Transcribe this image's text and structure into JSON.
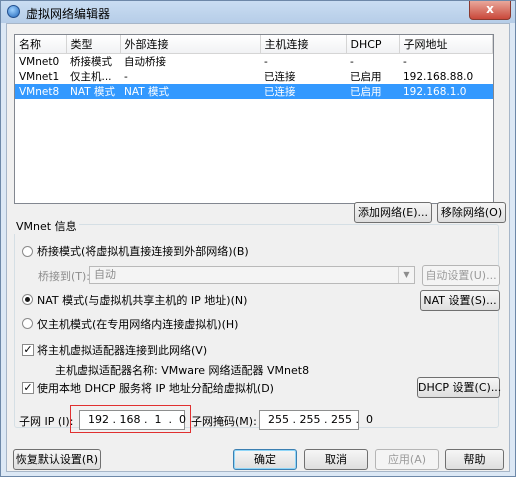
{
  "window": {
    "title": "虚拟网络编辑器",
    "close_glyph": "x"
  },
  "table": {
    "columns": [
      "名称",
      "类型",
      "外部连接",
      "主机连接",
      "DHCP",
      "子网地址"
    ],
    "rows": [
      [
        "VMnet0",
        "桥接模式",
        "自动桥接",
        "-",
        "-",
        "-"
      ],
      [
        "VMnet1",
        "仅主机...",
        "-",
        "已连接",
        "已启用",
        "192.168.88.0"
      ],
      [
        "VMnet8",
        "NAT 模式",
        "NAT 模式",
        "已连接",
        "已启用",
        "192.168.1.0"
      ]
    ],
    "selected_row": 2
  },
  "buttons": {
    "add_network": "添加网络(E)...",
    "remove_network": "移除网络(O)",
    "auto_settings": "自动设置(U)...",
    "nat_settings": "NAT 设置(S)...",
    "dhcp_settings": "DHCP 设置(C)...",
    "restore_defaults": "恢复默认设置(R)",
    "ok": "确定",
    "cancel": "取消",
    "apply": "应用(A)",
    "help": "帮助"
  },
  "vmnet_info": {
    "group_label": "VMnet 信息",
    "bridge_radio": "桥接模式(将虚拟机直接连接到外部网络)(B)",
    "bridge_to_label": "桥接到(T):",
    "bridge_to_value": "自动",
    "nat_radio": "NAT 模式(与虚拟机共享主机的 IP 地址)(N)",
    "host_only_radio": "仅主机模式(在专用网络内连接虚拟机)(H)",
    "selected_mode": "nat",
    "connect_adapter_check": "将主机虚拟适配器连接到此网络(V)",
    "adapter_name": "主机虚拟适配器名称: VMware 网络适配器 VMnet8",
    "dhcp_check": "使用本地 DHCP 服务将 IP 地址分配给虚拟机(D)"
  },
  "subnet": {
    "ip_label": "子网 IP (I):",
    "ip_value": "192 . 168 .  1  .  0",
    "mask_label": "子网掩码(M):",
    "mask_value": "255 . 255 . 255 .  0"
  }
}
